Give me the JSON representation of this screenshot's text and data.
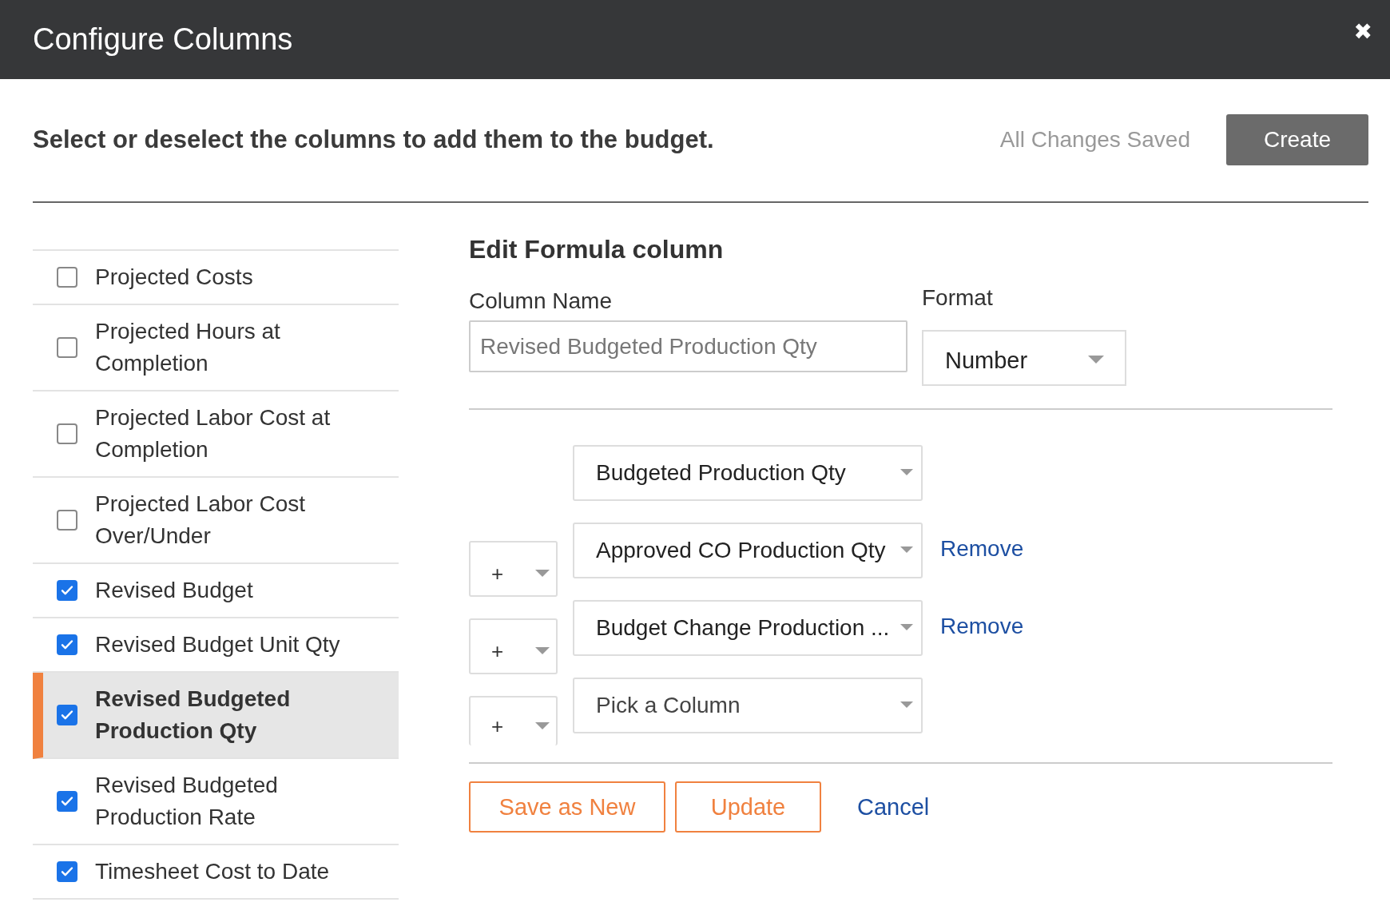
{
  "window": {
    "title": "Configure Columns",
    "close": "✖"
  },
  "header": {
    "instruction": "Select or deselect the columns to add them to the budget.",
    "save_status": "All Changes Saved",
    "create_button": "Create"
  },
  "columns": [
    {
      "label": "Projected Costs",
      "checked": false,
      "selected": false
    },
    {
      "label": "Projected Hours at Completion",
      "checked": false,
      "selected": false
    },
    {
      "label": "Projected Labor Cost at Completion",
      "checked": false,
      "selected": false
    },
    {
      "label": "Projected Labor Cost Over/Under",
      "checked": false,
      "selected": false
    },
    {
      "label": "Revised Budget",
      "checked": true,
      "selected": false
    },
    {
      "label": "Revised Budget Unit Qty",
      "checked": true,
      "selected": false
    },
    {
      "label": "Revised Budgeted Production Qty",
      "checked": true,
      "selected": true
    },
    {
      "label": "Revised Budgeted Production Rate",
      "checked": true,
      "selected": false
    },
    {
      "label": "Timesheet Cost to Date",
      "checked": true,
      "selected": false
    }
  ],
  "editor": {
    "title": "Edit Formula column",
    "column_name_label": "Column Name",
    "column_name_value": "Revised Budgeted Production Qty",
    "format_label": "Format",
    "format_value": "Number",
    "terms": [
      {
        "operand": "Budgeted Production Qty",
        "kind": "value"
      },
      {
        "operator": "+",
        "operand": "Approved CO Production Qty",
        "kind": "value",
        "remove": "Remove"
      },
      {
        "operator": "+",
        "operand": "Budget Change Production ...",
        "kind": "value",
        "remove": "Remove"
      },
      {
        "operator": "+",
        "operand": "Pick a Column",
        "kind": "placeholder"
      }
    ],
    "buttons": {
      "save_as_new": "Save as New",
      "update": "Update",
      "cancel": "Cancel"
    }
  }
}
